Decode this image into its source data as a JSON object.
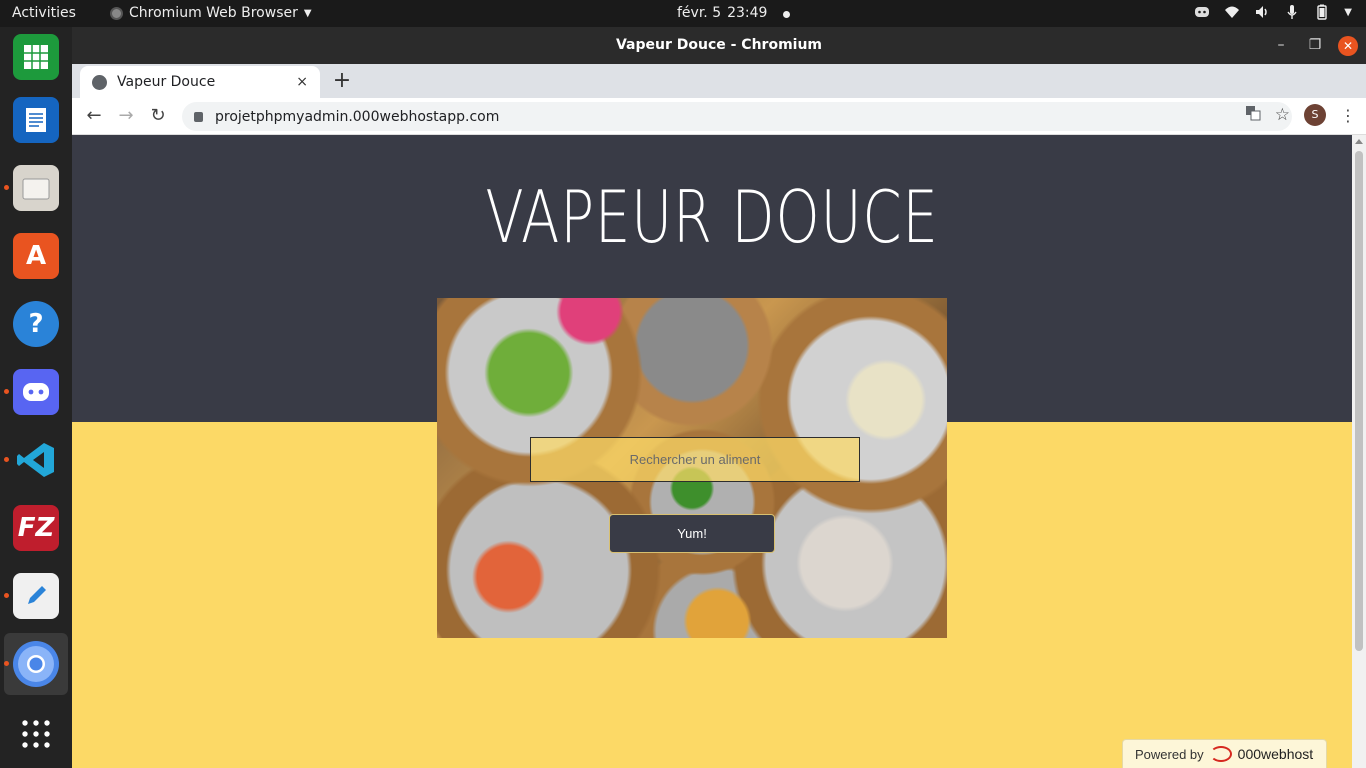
{
  "topbar": {
    "activities": "Activities",
    "app_name": "Chromium Web Browser",
    "date": "févr. 5",
    "time": "23:49",
    "tray_icons": [
      "discord-icon",
      "wifi-icon",
      "volume-icon",
      "microphone-icon",
      "battery-icon",
      "chevron-down-icon"
    ]
  },
  "dock": {
    "items": [
      {
        "name": "libreoffice-calc",
        "color": "#1d9a3c"
      },
      {
        "name": "libreoffice-writer",
        "color": "#1565c0"
      },
      {
        "name": "files",
        "color": "#d8d4cc"
      },
      {
        "name": "ubuntu-software",
        "color": "#e95420"
      },
      {
        "name": "help",
        "color": "#2a83d8"
      },
      {
        "name": "discord",
        "color": "#5865f2"
      },
      {
        "name": "vscode",
        "color": "#22a7d8"
      },
      {
        "name": "filezilla",
        "color": "#bf1e2d"
      },
      {
        "name": "text-editor",
        "color": "#f0f0f0"
      },
      {
        "name": "chromium",
        "color": "#4a86e8"
      },
      {
        "name": "show-apps",
        "color": "#ffffff"
      }
    ]
  },
  "window": {
    "title": "Vapeur Douce - Chromium"
  },
  "tab": {
    "title": "Vapeur Douce",
    "close": "×",
    "new_tab": "+"
  },
  "toolbar": {
    "url": "projetphpmyadmin.000webhostapp.com",
    "avatar_letter": "S",
    "back": "←",
    "forward": "→",
    "reload": "↻"
  },
  "page": {
    "site_title": "VAPEUR DOUCE",
    "search_placeholder": "Rechercher un aliment",
    "search_button": "Yum!",
    "colors": {
      "hero": "#393b46",
      "background": "#fcd966"
    }
  },
  "footer_badge": {
    "powered_by": "Powered by",
    "brand": "000webhost"
  }
}
